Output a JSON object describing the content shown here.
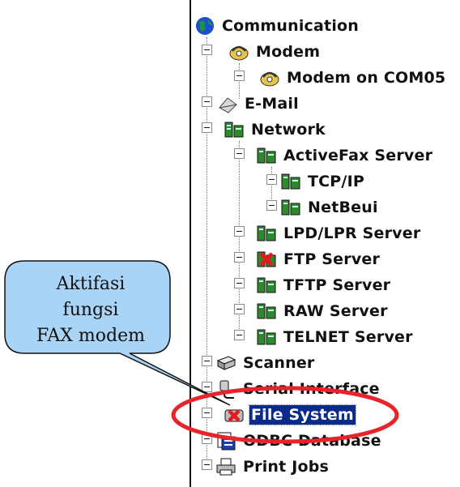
{
  "tree": {
    "items": [
      {
        "label": "Communication",
        "icon": "globe-icon"
      },
      {
        "label": "Modem",
        "icon": "modem-icon"
      },
      {
        "label": "Modem on COM05",
        "icon": "modem-icon"
      },
      {
        "label": "E-Mail",
        "icon": "email-icon"
      },
      {
        "label": "Network",
        "icon": "network-icon"
      },
      {
        "label": "ActiveFax Server",
        "icon": "network-icon"
      },
      {
        "label": "TCP/IP",
        "icon": "network-icon"
      },
      {
        "label": "NetBeui",
        "icon": "network-icon"
      },
      {
        "label": "LPD/LPR Server",
        "icon": "network-icon"
      },
      {
        "label": "FTP Server",
        "icon": "network-disabled-icon"
      },
      {
        "label": "TFTP Server",
        "icon": "network-icon"
      },
      {
        "label": "RAW Server",
        "icon": "network-icon"
      },
      {
        "label": "TELNET Server",
        "icon": "network-icon"
      },
      {
        "label": "Scanner",
        "icon": "scanner-icon"
      },
      {
        "label": "Serial Interface",
        "icon": "serial-icon"
      },
      {
        "label": "File System",
        "icon": "file-system-disabled-icon",
        "selected": true
      },
      {
        "label": "ODBC Database",
        "icon": "database-icon"
      },
      {
        "label": "Print Jobs",
        "icon": "printer-icon"
      }
    ]
  },
  "callout": {
    "line1": "Aktifasi",
    "line2": "fungsi",
    "line3": "FAX modem"
  },
  "colors": {
    "callout_fill": "#a9d4f5",
    "highlight_ring": "#e8232a",
    "selection": "#0a2a8c"
  }
}
